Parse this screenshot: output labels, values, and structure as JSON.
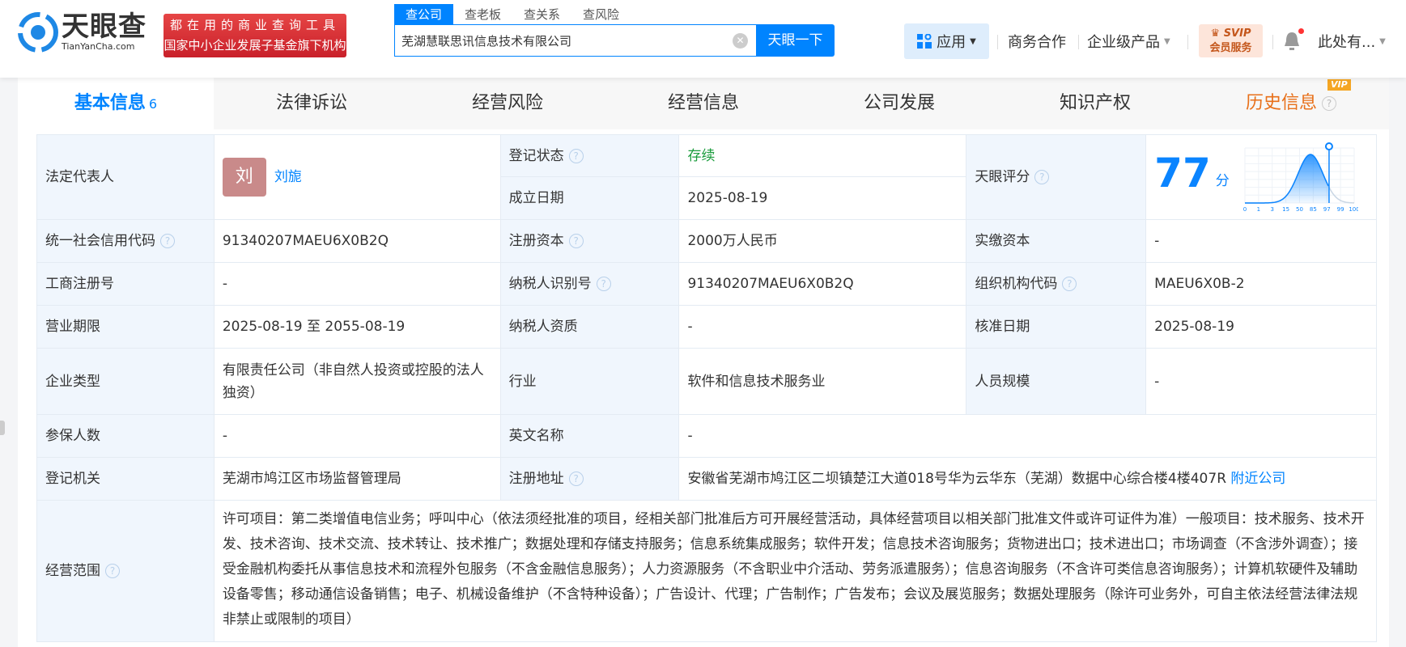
{
  "header": {
    "logo_cn": "天眼查",
    "logo_en": "TianYanCha.com",
    "slogan_line1": "都在用的商业查询工具",
    "slogan_line2": "国家中小企业发展子基金旗下机构",
    "search_tabs": [
      "查公司",
      "查老板",
      "查关系",
      "查风险"
    ],
    "search_value": "芜湖慧联思讯信息技术有限公司",
    "search_button": "天眼一下",
    "nav": {
      "apps": "应用",
      "business": "商务合作",
      "enterprise": "企业级产品",
      "svip_top": "SVIP",
      "svip_bottom": "会员服务",
      "user": "此处有..."
    }
  },
  "tabs": [
    {
      "label": "基本信息",
      "count": "6"
    },
    {
      "label": "法律诉讼"
    },
    {
      "label": "经营风险"
    },
    {
      "label": "经营信息"
    },
    {
      "label": "公司发展"
    },
    {
      "label": "知识产权"
    },
    {
      "label": "历史信息",
      "badge": "VIP"
    }
  ],
  "info": {
    "legal_rep_label": "法定代表人",
    "legal_rep_avatar": "刘",
    "legal_rep": "刘旎",
    "reg_status_label": "登记状态",
    "reg_status": "存续",
    "found_date_label": "成立日期",
    "found_date": "2025-08-19",
    "score_label": "天眼评分",
    "score": "77",
    "score_unit": "分",
    "credit_code_label": "统一社会信用代码",
    "credit_code": "91340207MAEU6X0B2Q",
    "reg_capital_label": "注册资本",
    "reg_capital": "2000万人民币",
    "paid_capital_label": "实缴资本",
    "paid_capital": "-",
    "biz_reg_no_label": "工商注册号",
    "biz_reg_no": "-",
    "taxpayer_id_label": "纳税人识别号",
    "taxpayer_id": "91340207MAEU6X0B2Q",
    "org_code_label": "组织机构代码",
    "org_code": "MAEU6X0B-2",
    "term_label": "营业期限",
    "term": "2025-08-19 至 2055-08-19",
    "taxpayer_qual_label": "纳税人资质",
    "taxpayer_qual": "-",
    "approve_date_label": "核准日期",
    "approve_date": "2025-08-19",
    "type_label": "企业类型",
    "type": "有限责任公司（非自然人投资或控股的法人独资）",
    "industry_label": "行业",
    "industry": "软件和信息技术服务业",
    "staff_label": "人员规模",
    "staff": "-",
    "insured_label": "参保人数",
    "insured": "-",
    "en_name_label": "英文名称",
    "en_name": "-",
    "authority_label": "登记机关",
    "authority": "芜湖市鸠江区市场监督管理局",
    "address_label": "注册地址",
    "address": "安徽省芜湖市鸠江区二坝镇楚江大道018号华为云华东（芜湖）数据中心综合楼4楼407R",
    "nearby": "附近公司",
    "scope_label": "经营范围",
    "scope": "许可项目：第二类增值电信业务；呼叫中心（依法须经批准的项目，经相关部门批准后方可开展经营活动，具体经营项目以相关部门批准文件或许可证件为准）一般项目：技术服务、技术开发、技术咨询、技术交流、技术转让、技术推广；数据处理和存储支持服务；信息系统集成服务；软件开发；信息技术咨询服务；货物进出口；技术进出口；市场调查（不含涉外调查）；接受金融机构委托从事信息技术和流程外包服务（不含金融信息服务）；人力资源服务（不含职业中介活动、劳务派遣服务）；信息咨询服务（不含许可类信息咨询服务）；计算机软硬件及辅助设备零售；移动通信设备销售；电子、机械设备维护（不含特种设备）；广告设计、代理；广告制作；广告发布；会议及展览服务；数据处理服务（除许可业务外，可自主依法经营法律法规非禁止或限制的项目）"
  },
  "score_chart": {
    "ticks": [
      "0",
      "1",
      "3",
      "15",
      "50",
      "85",
      "97",
      "99",
      "100"
    ],
    "marker_position_fraction": 0.77,
    "accent": "#0a84ff"
  }
}
